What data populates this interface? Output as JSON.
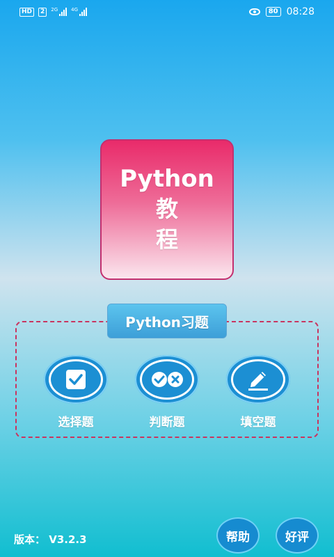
{
  "status_bar": {
    "hd_badge": "HD",
    "sim_badge": "2",
    "signal1_label": "2G",
    "signal2_label": "4G",
    "battery": "80",
    "time": "08:28"
  },
  "title_card": {
    "line1": "Python",
    "line2": "教",
    "line3": "程"
  },
  "exercise_section": {
    "label": "Python习题",
    "options": [
      {
        "label": "选择题",
        "icon": "checkbox-icon"
      },
      {
        "label": "判断题",
        "icon": "check-cross-icon"
      },
      {
        "label": "填空题",
        "icon": "pencil-icon"
      }
    ]
  },
  "footer": {
    "version": "版本： V3.2.3",
    "help_label": "帮助",
    "rate_label": "好评"
  }
}
